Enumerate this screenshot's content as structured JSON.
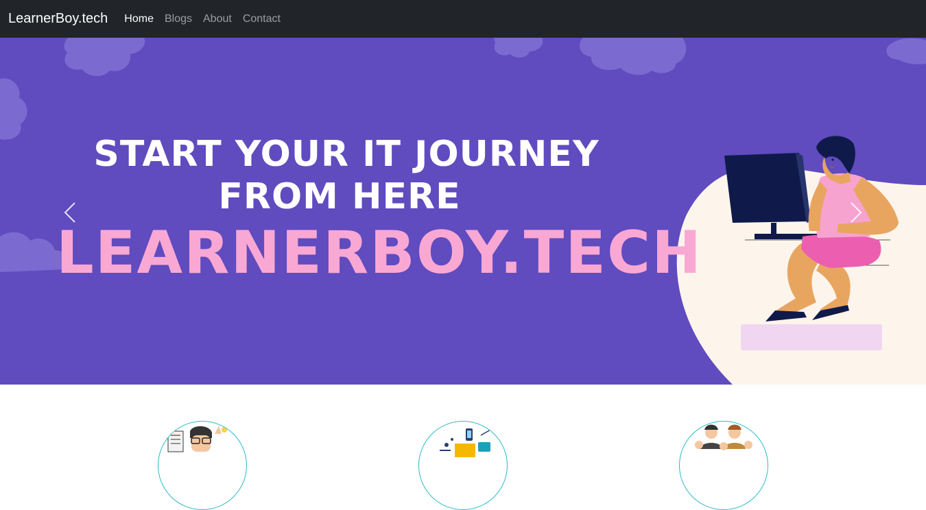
{
  "navbar": {
    "brand": "LearnerBoy.tech",
    "links": [
      {
        "label": "Home",
        "active": true
      },
      {
        "label": "Blogs",
        "active": false
      },
      {
        "label": "About",
        "active": false
      },
      {
        "label": "Contact",
        "active": false
      }
    ]
  },
  "hero": {
    "line1": "START YOUR IT JOURNEY",
    "line2": "FROM HERE",
    "line3": "LEARNERBOY.TECH",
    "prev_icon": "chevron-left-icon",
    "next_icon": "chevron-right-icon"
  },
  "colors": {
    "navbar": "#212529",
    "hero_bg": "#604bbf",
    "cloud": "#7b6ad0",
    "blob": "#fdf5ec",
    "accent_pink": "#f9a8d4",
    "circle_border": "#2bb8c8"
  },
  "features": [
    {
      "icon": "programmer-illustration-icon"
    },
    {
      "icon": "devices-illustration-icon"
    },
    {
      "icon": "people-illustration-icon"
    }
  ]
}
